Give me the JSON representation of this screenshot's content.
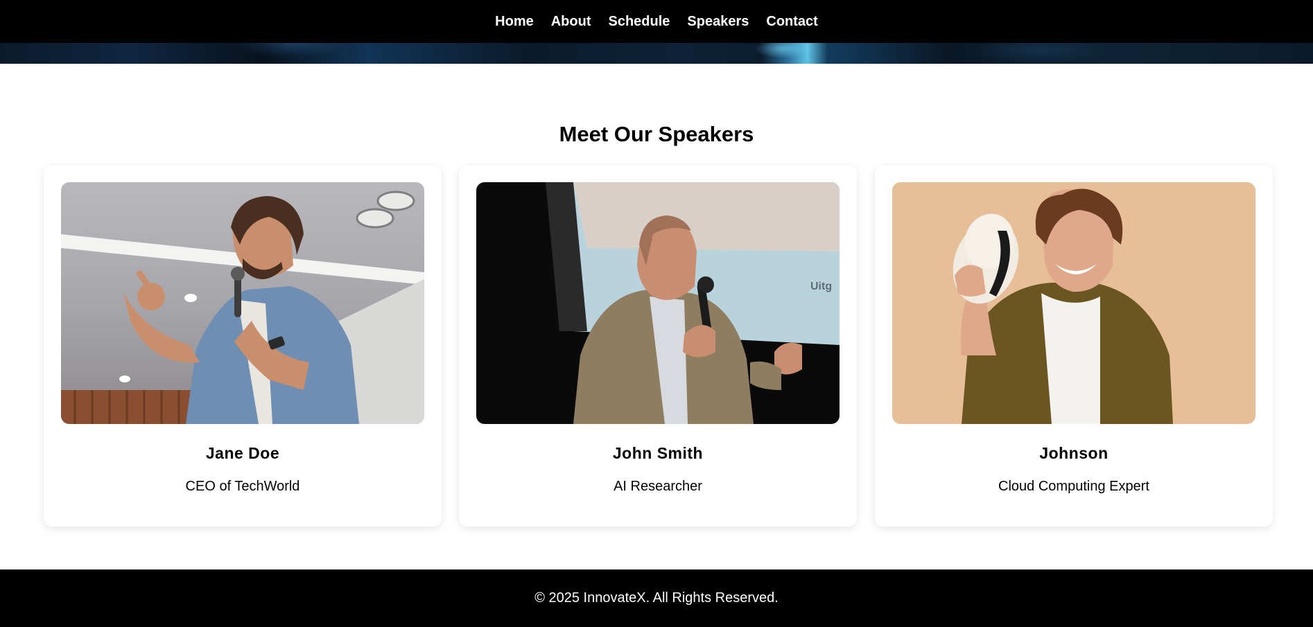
{
  "nav": {
    "items": [
      {
        "label": "Home"
      },
      {
        "label": "About"
      },
      {
        "label": "Schedule"
      },
      {
        "label": "Speakers"
      },
      {
        "label": "Contact"
      }
    ]
  },
  "speakers": {
    "title": "Meet Our Speakers",
    "cards": [
      {
        "name": "Jane Doe",
        "role": "CEO of TechWorld"
      },
      {
        "name": "John Smith",
        "role": "AI Researcher"
      },
      {
        "name": "Johnson",
        "role": "Cloud Computing Expert"
      }
    ]
  },
  "footer": {
    "text": "© 2025 InnovateX. All Rights Reserved."
  }
}
